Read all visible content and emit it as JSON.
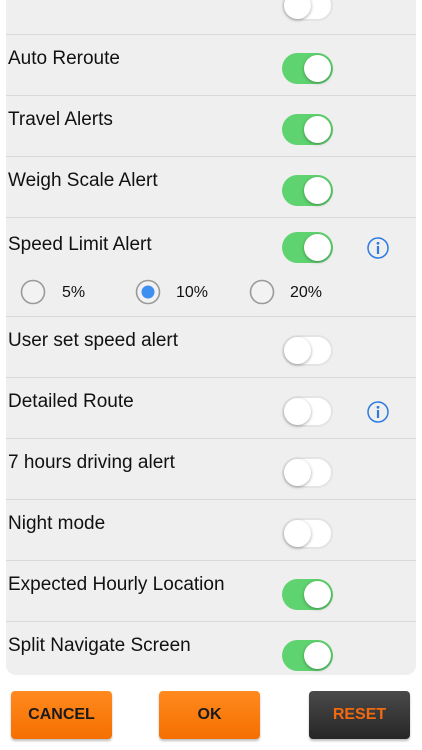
{
  "settings": {
    "items": [
      {
        "label": "",
        "on": false
      },
      {
        "label": "Auto Reroute",
        "on": true
      },
      {
        "label": "Travel Alerts",
        "on": true
      },
      {
        "label": "Weigh Scale Alert",
        "on": true
      },
      {
        "label": "Speed Limit Alert",
        "on": true,
        "info": true
      },
      {
        "label": "User set speed alert",
        "on": false
      },
      {
        "label": "Detailed Route",
        "on": false,
        "info": true
      },
      {
        "label": "7 hours driving alert",
        "on": false
      },
      {
        "label": "Night mode",
        "on": false
      },
      {
        "label": "Expected Hourly Location",
        "on": true
      },
      {
        "label": "Split Navigate Screen",
        "on": true
      }
    ],
    "speed_options": [
      {
        "label": "5%",
        "selected": false
      },
      {
        "label": "10%",
        "selected": true
      },
      {
        "label": "20%",
        "selected": false
      }
    ]
  },
  "footer": {
    "cancel_label": "CANCEL",
    "ok_label": "OK",
    "reset_label": "RESET"
  },
  "colors": {
    "toggle_on": "#5fd36f",
    "info_blue": "#2d7be0",
    "button_orange": "#f77a0c",
    "button_dark": "#333333",
    "reset_text": "#f26a10"
  },
  "icons": {
    "info": "info-circle-icon"
  }
}
